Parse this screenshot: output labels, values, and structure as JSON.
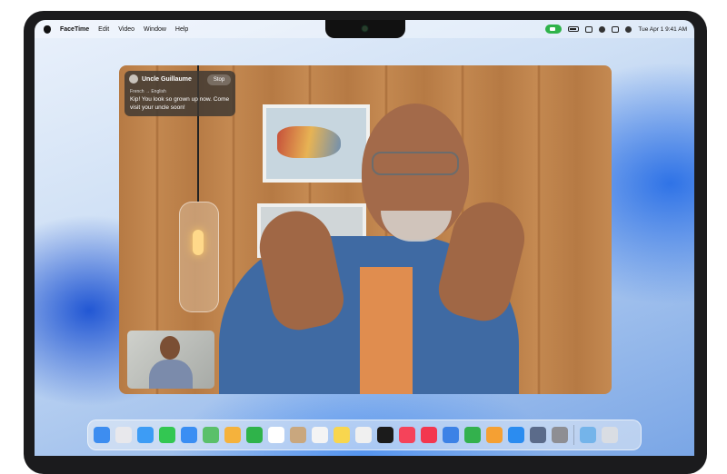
{
  "menubar": {
    "app_name": "FaceTime",
    "items": [
      "Edit",
      "Video",
      "Window",
      "Help"
    ],
    "clock": "Tue Apr 1  9:41 AM"
  },
  "caption": {
    "caller_name": "Uncle Guillaume",
    "stop_label": "Stop",
    "language": "French → English",
    "text": "Kip! You look so grown up now. Come visit your uncle soon!"
  },
  "dock": {
    "icons": [
      {
        "name": "finder-icon",
        "color": "#3d8df0"
      },
      {
        "name": "launchpad-icon",
        "color": "#e8e8ec"
      },
      {
        "name": "safari-icon",
        "color": "#3d9cf5"
      },
      {
        "name": "messages-icon",
        "color": "#33c752"
      },
      {
        "name": "mail-icon",
        "color": "#3a8ef3"
      },
      {
        "name": "maps-icon",
        "color": "#5ac06a"
      },
      {
        "name": "photos-icon",
        "color": "#f5b23c"
      },
      {
        "name": "facetime-icon",
        "color": "#2fb34a"
      },
      {
        "name": "calendar-icon",
        "color": "#ffffff"
      },
      {
        "name": "contacts-icon",
        "color": "#c9a77e"
      },
      {
        "name": "reminders-icon",
        "color": "#f4f4f4"
      },
      {
        "name": "notes-icon",
        "color": "#f8d64e"
      },
      {
        "name": "freeform-icon",
        "color": "#f0f0f0"
      },
      {
        "name": "tv-icon",
        "color": "#1b1b1b"
      },
      {
        "name": "music-icon",
        "color": "#f5435a"
      },
      {
        "name": "news-icon",
        "color": "#f3374f"
      },
      {
        "name": "keynote-icon",
        "color": "#3c82e6"
      },
      {
        "name": "numbers-icon",
        "color": "#33b14d"
      },
      {
        "name": "pages-icon",
        "color": "#f5a033"
      },
      {
        "name": "app-store-icon",
        "color": "#2b8cf0"
      },
      {
        "name": "iphone-mirroring-icon",
        "color": "#5b6b8a"
      },
      {
        "name": "system-settings-icon",
        "color": "#8e8e93"
      }
    ],
    "trailing": [
      {
        "name": "downloads-folder-icon",
        "color": "#74b4ea"
      },
      {
        "name": "trash-icon",
        "color": "#d9dde3"
      }
    ]
  }
}
